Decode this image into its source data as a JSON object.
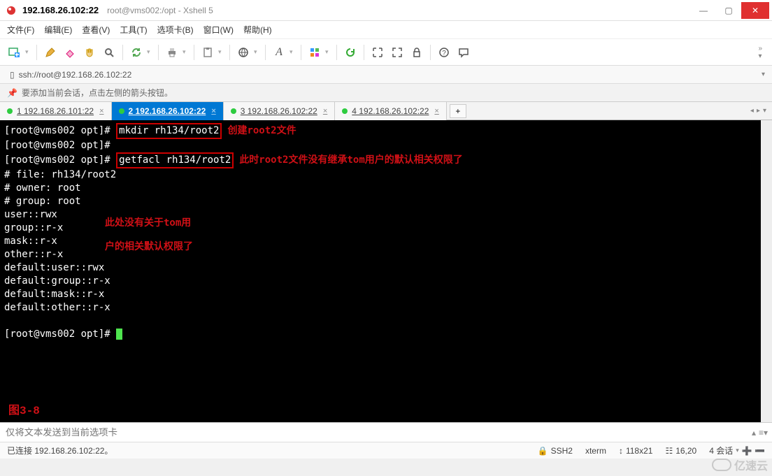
{
  "window": {
    "title_main": "192.168.26.102:22",
    "title_sub": "root@vms002:/opt - Xshell 5"
  },
  "menus": [
    "文件(F)",
    "编辑(E)",
    "查看(V)",
    "工具(T)",
    "选项卡(B)",
    "窗口(W)",
    "帮助(H)"
  ],
  "toolbar_icons": [
    "new-session-icon",
    "new-dropdown",
    "sep",
    "pencil-icon",
    "scissors-icon",
    "hand-icon",
    "search-icon",
    "sep",
    "reload-icon",
    "reload-dropdown",
    "sep",
    "print-icon",
    "print-dropdown",
    "sep",
    "clipboard-icon",
    "clipboard-dropdown",
    "sep",
    "globe-icon",
    "globe-dropdown",
    "sep",
    "font-icon",
    "font-dropdown",
    "sep",
    "palette-icon",
    "palette-dropdown",
    "sep",
    "refresh-icon",
    "sep",
    "expand-icon",
    "fullscreen-icon",
    "lock-icon",
    "sep",
    "help-icon",
    "comment-icon"
  ],
  "url": "ssh://root@192.168.26.102:22",
  "hint": "要添加当前会话，点击左侧的箭头按钮。",
  "tabs": [
    {
      "label": "1 192.168.26.101:22",
      "active": false
    },
    {
      "label": "2 192.168.26.102:22",
      "active": true
    },
    {
      "label": "3 192.168.26.102:22",
      "active": false
    },
    {
      "label": "4 192.168.26.102:22",
      "active": false
    }
  ],
  "terminal": {
    "prompt": "[root@vms002 opt]# ",
    "cmd1": "mkdir rh134/root2",
    "anno1": "创建root2文件",
    "cmd2": "getfacl rh134/root2",
    "anno2": "此时root2文件没有继承tom用户的默认相关权限了",
    "lines": [
      "# file: rh134/root2",
      "# owner: root",
      "# group: root",
      "user::rwx",
      "group::r-x",
      "mask::r-x",
      "other::r-x",
      "default:user::rwx",
      "default:group::r-x",
      "default:mask::r-x",
      "default:other::r-x"
    ],
    "side_anno_l1": "此处没有关于tom用",
    "side_anno_l2": "户的相关默认权限了",
    "figure_label": "图3-8"
  },
  "input_placeholder": "仅将文本发送到当前选项卡",
  "status": {
    "conn": "已连接 192.168.26.102:22。",
    "proto": "SSH2",
    "term": "xterm",
    "size": "118x21",
    "pos": "16,20",
    "sessions": "4 会话"
  },
  "watermark": "亿速云"
}
